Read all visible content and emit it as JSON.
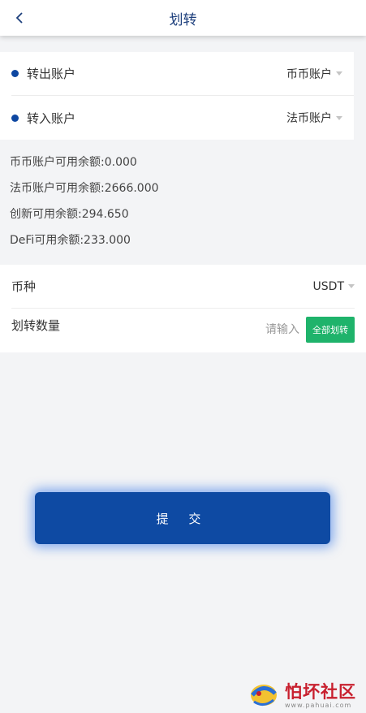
{
  "header": {
    "title": "划转"
  },
  "accounts": [
    {
      "label": "转出账户",
      "value": "币币账户"
    },
    {
      "label": "转入账户",
      "value": "法币账户"
    }
  ],
  "balances": [
    "币币账户可用余额:0.000",
    "法币账户可用余额:2666.000",
    "创新可用余额:294.650",
    "DeFi可用余额:233.000"
  ],
  "form": {
    "coin_label": "币种",
    "coin_value": "USDT",
    "amount_label": "划转数量",
    "amount_placeholder": "请输入",
    "all_button": "全部划转"
  },
  "submit_label": "提 交",
  "watermark": {
    "text": "怕坏社区",
    "sub": "www.pahuai.com"
  },
  "colors": {
    "primary": "#0e4aa3",
    "accent_green": "#1fb36b",
    "title": "#1d3f7c"
  }
}
